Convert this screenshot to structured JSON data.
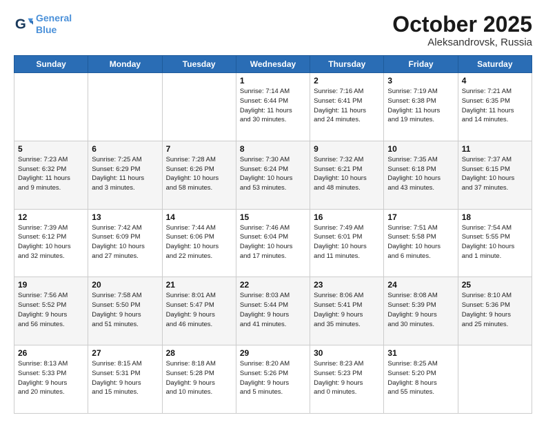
{
  "header": {
    "logo_line1": "General",
    "logo_line2": "Blue",
    "month": "October 2025",
    "location": "Aleksandrovsk, Russia"
  },
  "days_of_week": [
    "Sunday",
    "Monday",
    "Tuesday",
    "Wednesday",
    "Thursday",
    "Friday",
    "Saturday"
  ],
  "weeks": [
    [
      {
        "day": "",
        "text": ""
      },
      {
        "day": "",
        "text": ""
      },
      {
        "day": "",
        "text": ""
      },
      {
        "day": "1",
        "text": "Sunrise: 7:14 AM\nSunset: 6:44 PM\nDaylight: 11 hours\nand 30 minutes."
      },
      {
        "day": "2",
        "text": "Sunrise: 7:16 AM\nSunset: 6:41 PM\nDaylight: 11 hours\nand 24 minutes."
      },
      {
        "day": "3",
        "text": "Sunrise: 7:19 AM\nSunset: 6:38 PM\nDaylight: 11 hours\nand 19 minutes."
      },
      {
        "day": "4",
        "text": "Sunrise: 7:21 AM\nSunset: 6:35 PM\nDaylight: 11 hours\nand 14 minutes."
      }
    ],
    [
      {
        "day": "5",
        "text": "Sunrise: 7:23 AM\nSunset: 6:32 PM\nDaylight: 11 hours\nand 9 minutes."
      },
      {
        "day": "6",
        "text": "Sunrise: 7:25 AM\nSunset: 6:29 PM\nDaylight: 11 hours\nand 3 minutes."
      },
      {
        "day": "7",
        "text": "Sunrise: 7:28 AM\nSunset: 6:26 PM\nDaylight: 10 hours\nand 58 minutes."
      },
      {
        "day": "8",
        "text": "Sunrise: 7:30 AM\nSunset: 6:24 PM\nDaylight: 10 hours\nand 53 minutes."
      },
      {
        "day": "9",
        "text": "Sunrise: 7:32 AM\nSunset: 6:21 PM\nDaylight: 10 hours\nand 48 minutes."
      },
      {
        "day": "10",
        "text": "Sunrise: 7:35 AM\nSunset: 6:18 PM\nDaylight: 10 hours\nand 43 minutes."
      },
      {
        "day": "11",
        "text": "Sunrise: 7:37 AM\nSunset: 6:15 PM\nDaylight: 10 hours\nand 37 minutes."
      }
    ],
    [
      {
        "day": "12",
        "text": "Sunrise: 7:39 AM\nSunset: 6:12 PM\nDaylight: 10 hours\nand 32 minutes."
      },
      {
        "day": "13",
        "text": "Sunrise: 7:42 AM\nSunset: 6:09 PM\nDaylight: 10 hours\nand 27 minutes."
      },
      {
        "day": "14",
        "text": "Sunrise: 7:44 AM\nSunset: 6:06 PM\nDaylight: 10 hours\nand 22 minutes."
      },
      {
        "day": "15",
        "text": "Sunrise: 7:46 AM\nSunset: 6:04 PM\nDaylight: 10 hours\nand 17 minutes."
      },
      {
        "day": "16",
        "text": "Sunrise: 7:49 AM\nSunset: 6:01 PM\nDaylight: 10 hours\nand 11 minutes."
      },
      {
        "day": "17",
        "text": "Sunrise: 7:51 AM\nSunset: 5:58 PM\nDaylight: 10 hours\nand 6 minutes."
      },
      {
        "day": "18",
        "text": "Sunrise: 7:54 AM\nSunset: 5:55 PM\nDaylight: 10 hours\nand 1 minute."
      }
    ],
    [
      {
        "day": "19",
        "text": "Sunrise: 7:56 AM\nSunset: 5:52 PM\nDaylight: 9 hours\nand 56 minutes."
      },
      {
        "day": "20",
        "text": "Sunrise: 7:58 AM\nSunset: 5:50 PM\nDaylight: 9 hours\nand 51 minutes."
      },
      {
        "day": "21",
        "text": "Sunrise: 8:01 AM\nSunset: 5:47 PM\nDaylight: 9 hours\nand 46 minutes."
      },
      {
        "day": "22",
        "text": "Sunrise: 8:03 AM\nSunset: 5:44 PM\nDaylight: 9 hours\nand 41 minutes."
      },
      {
        "day": "23",
        "text": "Sunrise: 8:06 AM\nSunset: 5:41 PM\nDaylight: 9 hours\nand 35 minutes."
      },
      {
        "day": "24",
        "text": "Sunrise: 8:08 AM\nSunset: 5:39 PM\nDaylight: 9 hours\nand 30 minutes."
      },
      {
        "day": "25",
        "text": "Sunrise: 8:10 AM\nSunset: 5:36 PM\nDaylight: 9 hours\nand 25 minutes."
      }
    ],
    [
      {
        "day": "26",
        "text": "Sunrise: 8:13 AM\nSunset: 5:33 PM\nDaylight: 9 hours\nand 20 minutes."
      },
      {
        "day": "27",
        "text": "Sunrise: 8:15 AM\nSunset: 5:31 PM\nDaylight: 9 hours\nand 15 minutes."
      },
      {
        "day": "28",
        "text": "Sunrise: 8:18 AM\nSunset: 5:28 PM\nDaylight: 9 hours\nand 10 minutes."
      },
      {
        "day": "29",
        "text": "Sunrise: 8:20 AM\nSunset: 5:26 PM\nDaylight: 9 hours\nand 5 minutes."
      },
      {
        "day": "30",
        "text": "Sunrise: 8:23 AM\nSunset: 5:23 PM\nDaylight: 9 hours\nand 0 minutes."
      },
      {
        "day": "31",
        "text": "Sunrise: 8:25 AM\nSunset: 5:20 PM\nDaylight: 8 hours\nand 55 minutes."
      },
      {
        "day": "",
        "text": ""
      }
    ]
  ]
}
